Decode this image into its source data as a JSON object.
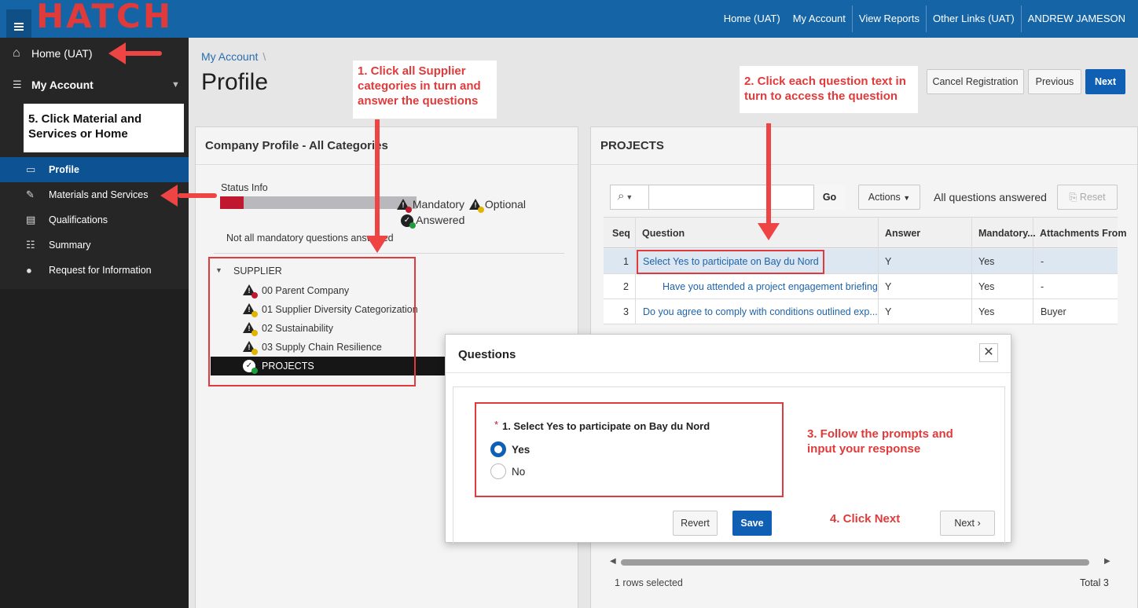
{
  "app": {
    "logo": "HATCH"
  },
  "topnav": [
    "Home (UAT)",
    "My Account",
    "View Reports",
    "Other Links (UAT)",
    "ANDREW JAMESON"
  ],
  "sidebar": {
    "home": "Home (UAT)",
    "my_account": "My Account",
    "items": [
      {
        "label": "Profile",
        "icon": "id-card-icon"
      },
      {
        "label": "Materials and Services",
        "icon": "tools-icon"
      },
      {
        "label": "Qualifications",
        "icon": "certificate-icon"
      },
      {
        "label": "Summary",
        "icon": "summary-icon"
      },
      {
        "label": "Request for Information",
        "icon": "chat-icon"
      }
    ]
  },
  "header": {
    "breadcrumb": "My Account",
    "title": "Profile",
    "buttons": {
      "cancel": "Cancel Registration",
      "previous": "Previous",
      "next": "Next"
    }
  },
  "company_profile": {
    "title": "Company Profile - All Categories",
    "status_label": "Status Info",
    "progress": 0.12,
    "legend": {
      "mandatory": "Mandatory",
      "optional": "Optional",
      "answered": "Answered"
    },
    "status_text": "Not all mandatory questions answered",
    "tree": {
      "root": "SUPPLIER",
      "items": [
        {
          "label": "00 Parent Company",
          "status": "mandatory"
        },
        {
          "label": "01 Supplier Diversity Categorization",
          "status": "optional"
        },
        {
          "label": "02 Sustainability",
          "status": "optional"
        },
        {
          "label": "03 Supply Chain Resilience",
          "status": "optional"
        },
        {
          "label": "PROJECTS",
          "status": "answered"
        }
      ]
    }
  },
  "projects": {
    "title": "PROJECTS",
    "go": "Go",
    "actions": "Actions",
    "all_answered": "All questions answered",
    "reset": "Reset",
    "columns": [
      "Seq",
      "Question",
      "Answer",
      "Mandatory...",
      "Attachments From"
    ],
    "rows": [
      {
        "seq": "1",
        "question": "Select Yes to participate on Bay du Nord",
        "answer": "Y",
        "mandatory": "Yes",
        "attachments": "-"
      },
      {
        "seq": "2",
        "question": "Have you attended a project engagement briefing",
        "answer": "Y",
        "mandatory": "Yes",
        "attachments": "-"
      },
      {
        "seq": "3",
        "question": "Do you agree to comply with conditions outlined exp...",
        "answer": "Y",
        "mandatory": "Yes",
        "attachments": "Buyer"
      }
    ],
    "footer_selected": "1 rows selected",
    "footer_total": "Total 3"
  },
  "dialog": {
    "title": "Questions",
    "required_mark": "*",
    "question": "1. Select Yes to participate on Bay du Nord",
    "options": [
      "Yes",
      "No"
    ],
    "selected": "Yes",
    "revert": "Revert",
    "save": "Save",
    "next": "Next"
  },
  "annotations": {
    "step1": "1. Click all Supplier categories in turn and answer the questions",
    "step2": "2. Click each question text in turn to access the question",
    "step3": "3. Follow the prompts and input your response",
    "step4": "4. Click Next",
    "step5": "5. Click Material and Services or Home"
  }
}
